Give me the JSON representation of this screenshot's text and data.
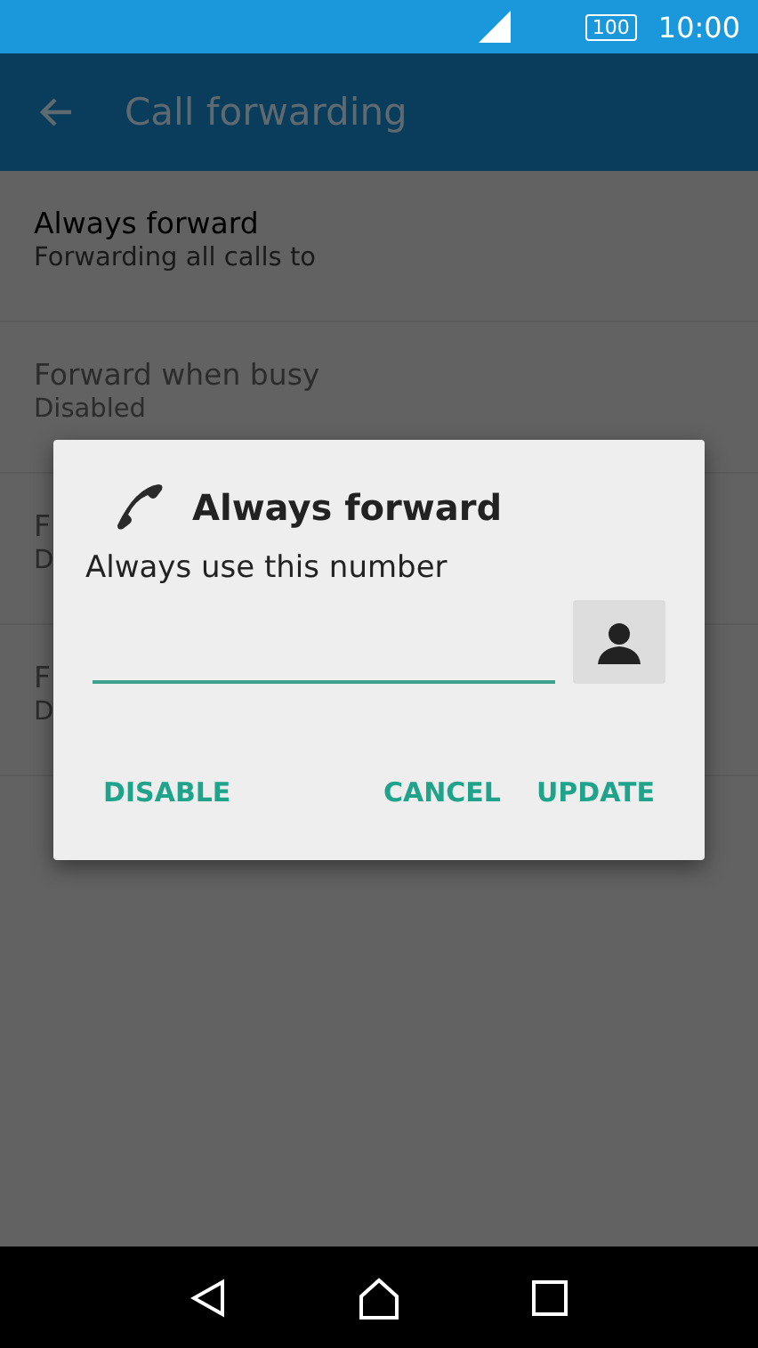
{
  "status_bar": {
    "battery": "100",
    "time": "10:00"
  },
  "toolbar": {
    "title": "Call forwarding"
  },
  "settings": [
    {
      "title": "Always forward",
      "summary": "Forwarding all calls to",
      "disabled": false
    },
    {
      "title": "Forward when busy",
      "summary": "Disabled",
      "disabled": true
    },
    {
      "title": "F",
      "summary": "D",
      "disabled": true
    },
    {
      "title": "F",
      "summary": "D",
      "disabled": true
    }
  ],
  "dialog": {
    "title": "Always forward",
    "message": "Always use this number",
    "buttons": [
      {
        "label": "DISABLE"
      },
      {
        "label": "CANCEL"
      },
      {
        "label": "UPDATE"
      }
    ]
  }
}
